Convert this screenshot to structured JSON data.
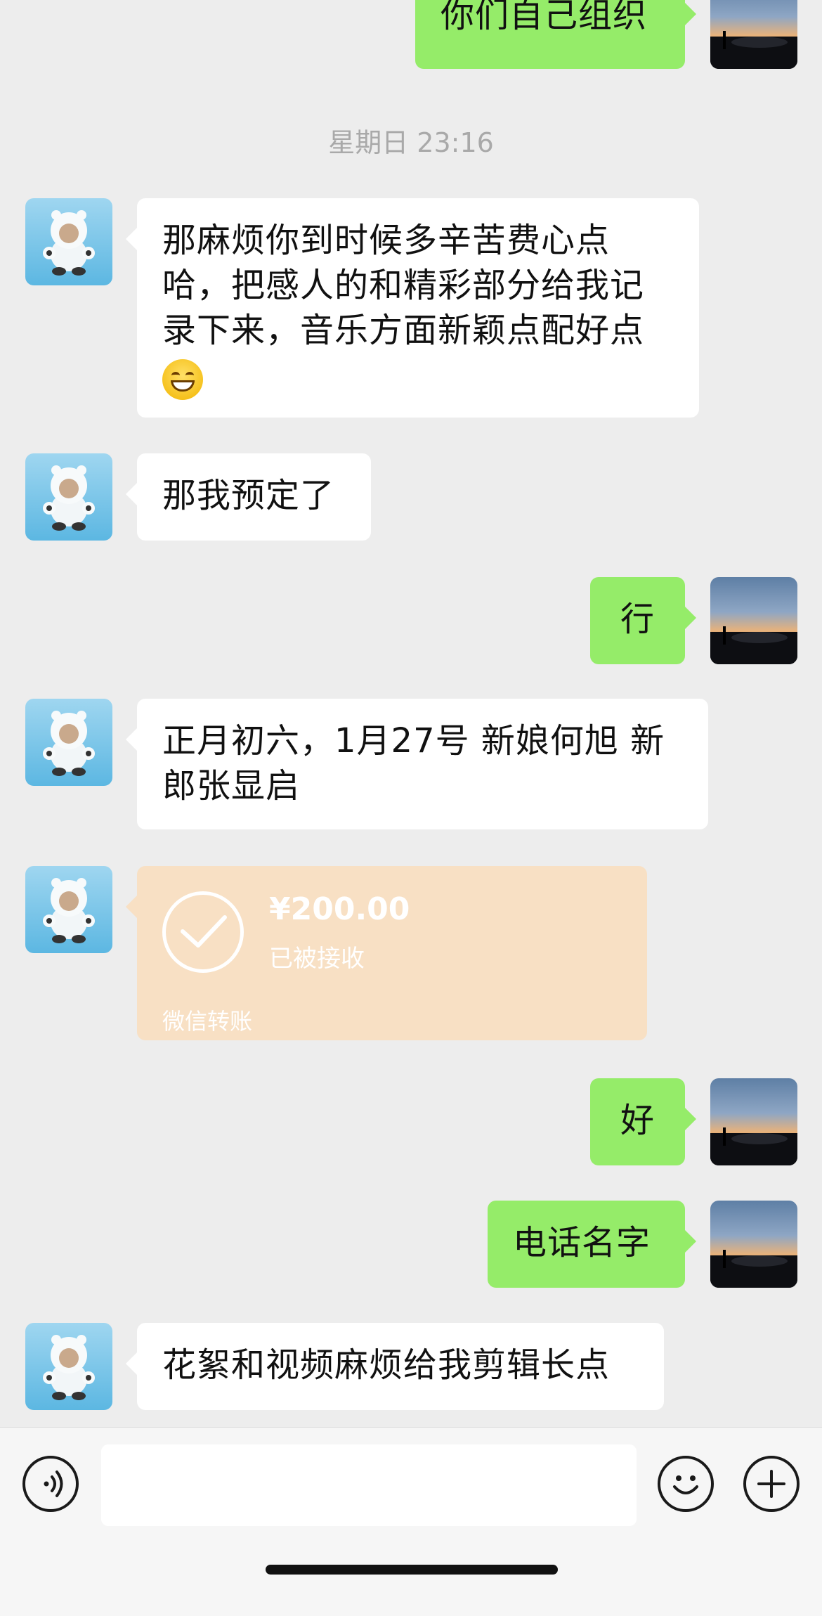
{
  "timestamp": "星期日 23:16",
  "messages": {
    "top_partial": "你们自己组织",
    "m1": "那麻烦你到时候多辛苦费心点哈，把感人的和精彩部分给我记录下来，音乐方面新颖点配好点",
    "m1_emoji": "grinning-face-emoji",
    "m2": "那我预定了",
    "m3": "行",
    "m4_line1": "正月初六，1月27号 新娘何旭 新",
    "m4_line2": "郎张显启",
    "m6": "好",
    "m7": "电话名字",
    "m8": "花絮和视频麻烦给我剪辑长点"
  },
  "transfer": {
    "amount": "¥200.00",
    "status": "已被接收",
    "label": "微信转账",
    "color": "#f8e0c4"
  },
  "input": {
    "value": "",
    "placeholder": ""
  },
  "icons": {
    "voice": "voice-icon",
    "emoji": "emoji-icon",
    "plus": "plus-icon"
  },
  "colors": {
    "background": "#ededed",
    "sent_bubble": "#95ec69",
    "received_bubble": "#ffffff"
  }
}
